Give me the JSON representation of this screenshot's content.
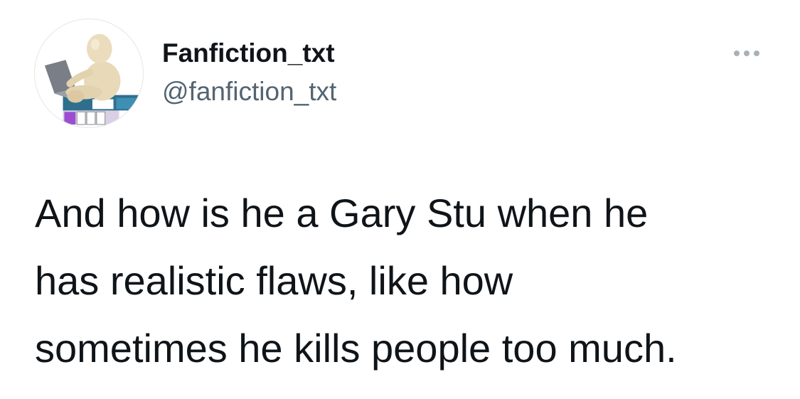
{
  "tweet": {
    "display_name": "Fanfiction_txt",
    "handle": "@fanfiction_txt",
    "more_icon": "more-horizontal-icon",
    "text_lines": [
      "And how is he a Gary Stu when he",
      "has realistic flaws, like how",
      "sometimes he kills people too much."
    ]
  },
  "colors": {
    "text": "#0f1419",
    "secondary": "#536471",
    "more_icon": "#a8b0b8",
    "background": "#ffffff"
  }
}
